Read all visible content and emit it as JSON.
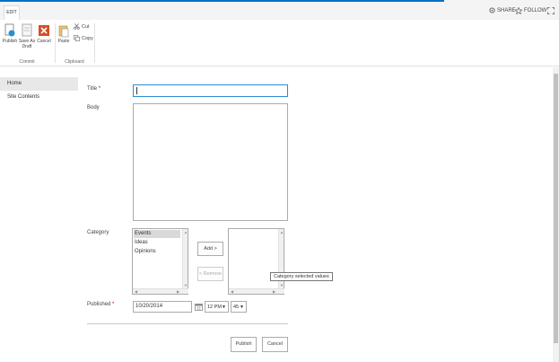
{
  "tabbar": {
    "edit_tab": "EDIT",
    "share": "SHARE",
    "follow": "FOLLOW"
  },
  "ribbon": {
    "publish": "Publish",
    "save_as_draft_1": "Save As",
    "save_as_draft_2": "Draft",
    "cancel": "Cancel",
    "paste": "Paste",
    "cut": "Cut",
    "copy": "Copy",
    "group_commit": "Commit",
    "group_clipboard": "Clipboard"
  },
  "nav": {
    "home": "Home",
    "site_contents": "Site Contents"
  },
  "form": {
    "title_label": "Title",
    "required_mark": "*",
    "body_label": "Body",
    "category_label": "Category",
    "category_options": [
      "Events",
      "Ideas",
      "Opinions"
    ],
    "add_button": "Add >",
    "remove_button": "< Remove",
    "tooltip": "Category selected values",
    "published_label": "Published",
    "date_value": "10/20/2014",
    "hour_value": "12 PM",
    "minute_value": "45",
    "publish_button": "Publish",
    "cancel_button": "Cancel"
  },
  "colors": {
    "accent": "#0072c6",
    "required": "#bf0000",
    "cancel_icon": "#d74e26",
    "focus": "#2a8dd4"
  }
}
